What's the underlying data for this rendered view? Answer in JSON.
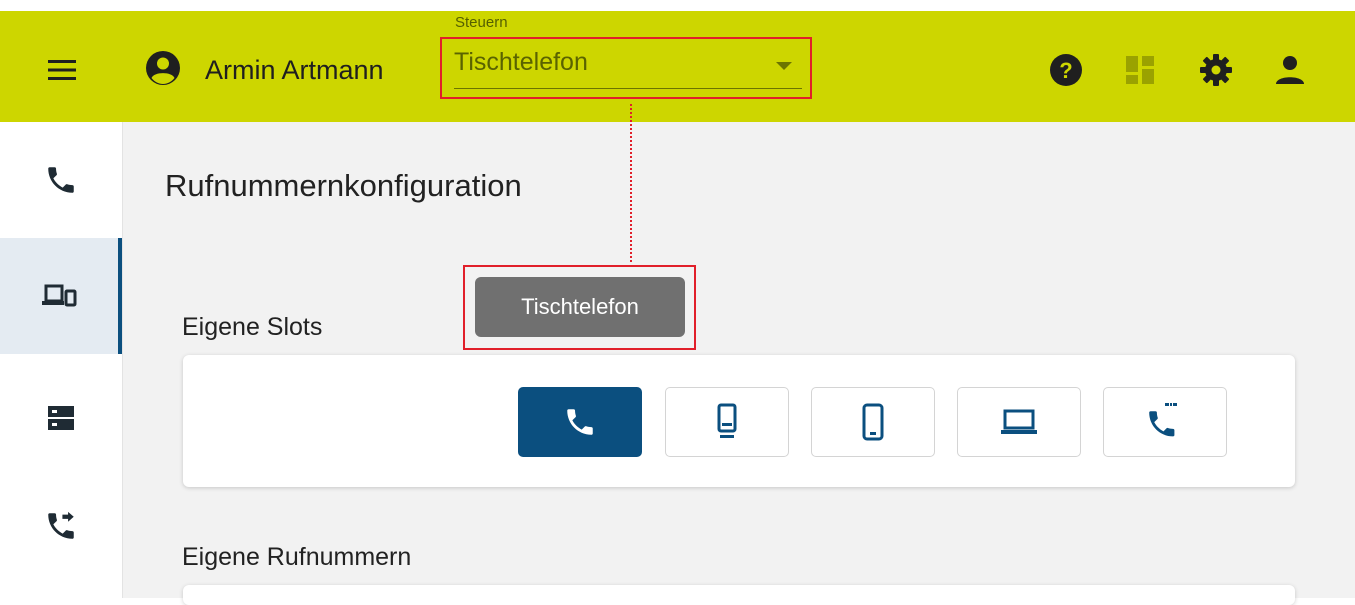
{
  "header": {
    "user_name": "Armin Artmann",
    "control": {
      "label": "Steuern",
      "value": "Tischtelefon"
    }
  },
  "page": {
    "title": "Rufnummernkonfiguration",
    "tooltip": "Tischtelefon",
    "sections": {
      "slots": "Eigene Slots",
      "numbers": "Eigene Rufnummern"
    }
  },
  "colors": {
    "header_bg": "#cdd600",
    "accent": "#0b4f7f",
    "highlight": "#e11f2a",
    "tooltip_bg": "#707070"
  },
  "icons": {
    "header": [
      "menu-icon",
      "account-circle-icon",
      "help-icon",
      "dashboard-icon",
      "gear-icon",
      "person-icon"
    ],
    "sidebar": [
      "phone-icon",
      "devices-icon",
      "server-icon",
      "call-forward-icon"
    ],
    "slots": [
      "phone-icon",
      "desk-phone-icon",
      "mobile-phone-icon",
      "laptop-icon",
      "sip-phone-icon"
    ]
  }
}
